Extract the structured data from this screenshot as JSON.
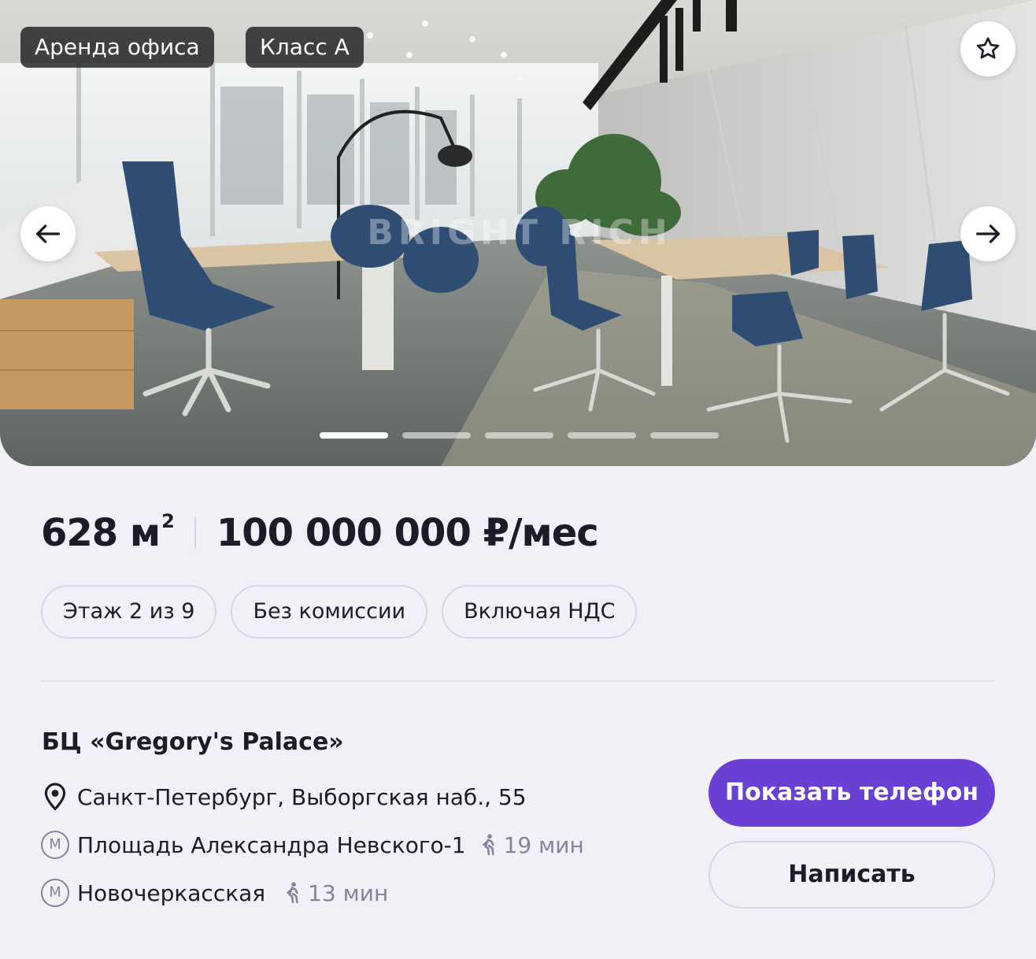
{
  "gallery": {
    "tag_type": "Аренда офиса",
    "tag_class": "Класс А",
    "watermark": "BRIGHT RICH",
    "slides_total": 5,
    "active_slide": 1
  },
  "listing": {
    "area_value": "628 м",
    "area_sup": "2",
    "price": "100 000 000 ₽/мес",
    "chips": [
      "Этаж 2 из 9",
      "Без комиссии",
      "Включая НДС"
    ]
  },
  "building": {
    "name": "БЦ «Gregory's Palace»",
    "address": "Санкт-Петербург, Выборгская наб., 55",
    "metro_badge": "М",
    "metro": [
      {
        "station": "Площадь Александра Невского-1",
        "walk": "19 мин"
      },
      {
        "station": "Новочеркасская",
        "walk": "13 мин"
      }
    ]
  },
  "actions": {
    "show_phone": "Показать телефон",
    "write": "Написать"
  },
  "colors": {
    "accent": "#6a3fd4",
    "page_bg": "#f1f0f6",
    "text": "#1c1b29",
    "muted": "#85839a"
  },
  "icons": {
    "favorite": "star-icon",
    "prev": "arrow-left-icon",
    "next": "arrow-right-icon",
    "address": "map-pin-icon",
    "metro": "metro-icon",
    "walk": "walking-person-icon"
  }
}
